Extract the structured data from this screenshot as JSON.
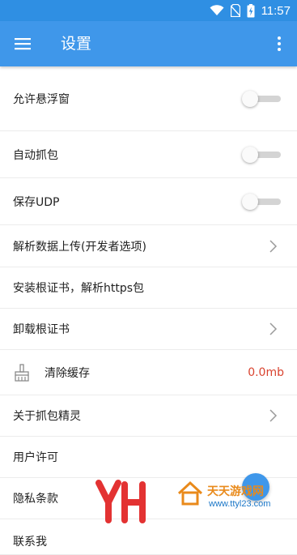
{
  "status_bar": {
    "time": "11:57",
    "icons": [
      "wifi-icon",
      "no-sim-icon",
      "battery-charging-icon"
    ]
  },
  "app_bar": {
    "title": "设置",
    "menu_icon": "hamburger-menu-icon",
    "more_icon": "more-vert-icon"
  },
  "settings": [
    {
      "label": "允许悬浮窗",
      "control": "toggle",
      "on": false
    },
    {
      "label": "自动抓包",
      "control": "toggle",
      "on": false
    },
    {
      "label": "保存UDP",
      "control": "toggle",
      "on": false
    },
    {
      "label": "解析数据上传(开发者选项)",
      "control": "chevron"
    },
    {
      "label": "安装根证书，解析https包",
      "control": "none"
    },
    {
      "label": "卸载根证书",
      "control": "chevron"
    },
    {
      "label": "清除缓存",
      "control": "value",
      "value": "0.0mb",
      "icon": "brush-icon"
    },
    {
      "label": "关于抓包精灵",
      "control": "chevron"
    },
    {
      "label": "用户许可",
      "control": "none"
    },
    {
      "label": "隐私条款",
      "control": "none"
    },
    {
      "label": "联系我",
      "control": "none"
    }
  ],
  "watermark": {
    "brand": "天天游戏网",
    "url": "www.ttyl23.com"
  },
  "colors": {
    "primary": "#3f97ea",
    "status_bar": "#2f8fe3",
    "value_red": "#d9432f",
    "divider": "#ececec"
  }
}
